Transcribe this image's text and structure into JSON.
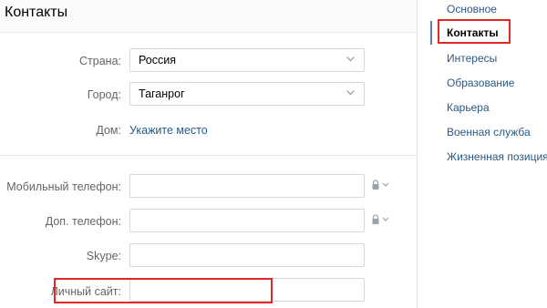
{
  "header": {
    "title": "Контакты"
  },
  "form": {
    "country": {
      "label": "Страна:",
      "value": "Россия"
    },
    "city": {
      "label": "Город:",
      "value": "Таганрог"
    },
    "home": {
      "label": "Дом:",
      "link": "Укажите место"
    },
    "mobile": {
      "label": "Мобильный телефон:",
      "value": ""
    },
    "extra_phone": {
      "label": "Доп. телефон:",
      "value": ""
    },
    "skype": {
      "label": "Skype:",
      "value": ""
    },
    "website": {
      "label": "Личный сайт:",
      "value": ""
    }
  },
  "sidebar": {
    "items": [
      {
        "label": "Основное",
        "active": false
      },
      {
        "label": "Контакты",
        "active": true
      },
      {
        "label": "Интересы",
        "active": false
      },
      {
        "label": "Образование",
        "active": false
      },
      {
        "label": "Карьера",
        "active": false
      },
      {
        "label": "Военная служба",
        "active": false
      },
      {
        "label": "Жизненная позиция",
        "active": false
      }
    ]
  },
  "colors": {
    "link": "#2a5885",
    "label": "#656565",
    "highlight": "#e2262a",
    "accent": "#5181b8"
  },
  "icons": {
    "privacy": "lock-icon",
    "dropdown": "chevron-down-icon"
  }
}
